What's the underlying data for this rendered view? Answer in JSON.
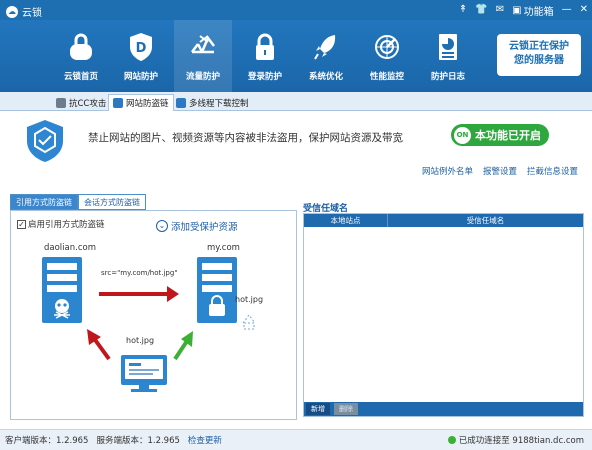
{
  "window": {
    "title": "云锁",
    "function_box": "功能箱"
  },
  "toolbar": {
    "items": [
      {
        "label": "云锁首页",
        "icon": "cloud-lock-icon"
      },
      {
        "label": "网站防护",
        "icon": "shield-d-icon"
      },
      {
        "label": "流量防护",
        "icon": "traffic-icon"
      },
      {
        "label": "登录防护",
        "icon": "padlock-icon"
      },
      {
        "label": "系统优化",
        "icon": "rocket-icon"
      },
      {
        "label": "性能监控",
        "icon": "radar-icon"
      },
      {
        "label": "防护日志",
        "icon": "log-icon"
      }
    ],
    "active_index": 2,
    "brand_line1": "云锁正在保护",
    "brand_line2": "您的服务器"
  },
  "tabs": [
    {
      "label": "抗CC攻击",
      "active": false
    },
    {
      "label": "网站防盗链",
      "active": true
    },
    {
      "label": "多线程下载控制",
      "active": false
    }
  ],
  "banner": {
    "description": "禁止网站的图片、视频资源等内容被非法盗用，保护网站资源及带宽",
    "toggle_badge": "ON",
    "toggle_label": "本功能已开启",
    "links": [
      "网站例外名单",
      "报警设置",
      "拦截信息设置"
    ]
  },
  "left": {
    "subtabs": [
      {
        "label": "引用方式防盗链",
        "active": true
      },
      {
        "label": "会话方式防盗链",
        "active": false
      }
    ],
    "checkbox_label": "启用引用方式防盗链",
    "checkbox_checked": true,
    "add_resource_label": "添加受保护资源",
    "diagram": {
      "domain_left": "daolian.com",
      "domain_right": "my.com",
      "src_label": "src=\"my.com/hot.jpg\"",
      "file_right": "hot.jpg",
      "file_bottom": "hot.jpg"
    }
  },
  "right": {
    "title": "受信任域名",
    "columns": [
      "本地站点",
      "受信任域名"
    ],
    "rows": [],
    "add_button": "新增",
    "delete_button": "删除"
  },
  "status": {
    "client_version": "客户端版本：1.2.965",
    "server_version": "服务端版本：1.2.965",
    "check_update": "检查更新",
    "connection": "已成功连接至 9188tian.dc.com"
  },
  "colors": {
    "primary": "#1d6fb2",
    "success": "#2ea83e",
    "arrow_red": "#c0171c",
    "arrow_green": "#3cb034"
  }
}
